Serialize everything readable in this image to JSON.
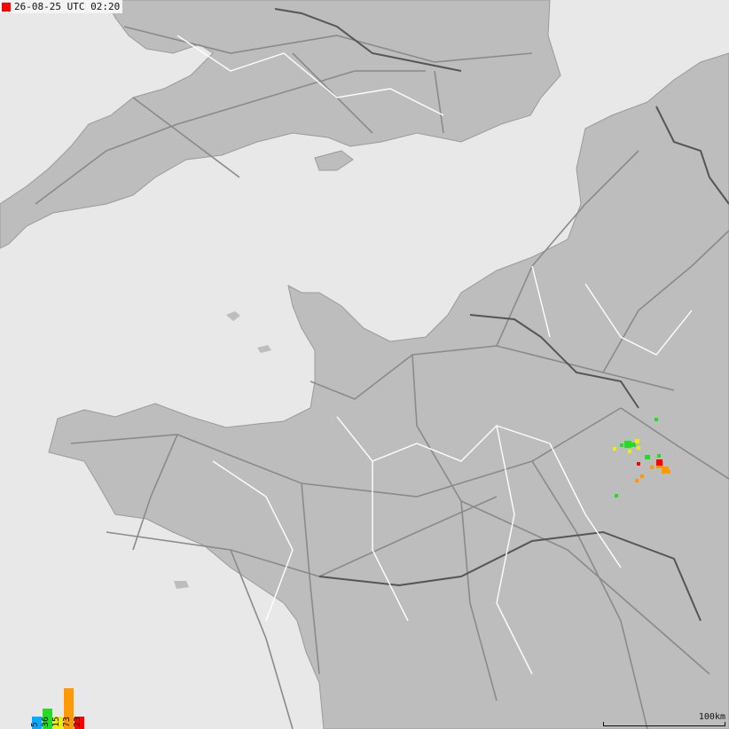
{
  "header": {
    "timestamp": "26-08-25 UTC 02:20",
    "marker_color": "#ff0000"
  },
  "colors": {
    "sea": "#e8e8e8",
    "land": "#bdbdbd",
    "roads": "#8a8a8a",
    "borders": "#ffffff",
    "rivers": "#555555"
  },
  "legend": [
    {
      "label": "5",
      "color": "#00aaff",
      "value": 5
    },
    {
      "label": "36",
      "color": "#22dd22",
      "value": 36
    },
    {
      "label": "15",
      "color": "#eeee00",
      "value": 15
    },
    {
      "label": "73",
      "color": "#ff9900",
      "value": 73
    },
    {
      "label": "23",
      "color": "#ff0000",
      "value": 23
    }
  ],
  "scale": {
    "label": "100km"
  },
  "strikes": [
    {
      "color": "#22dd22",
      "count": 12
    },
    {
      "color": "#eeee00",
      "count": 8
    },
    {
      "color": "#ff9900",
      "count": 14
    },
    {
      "color": "#ff0000",
      "count": 3
    }
  ]
}
